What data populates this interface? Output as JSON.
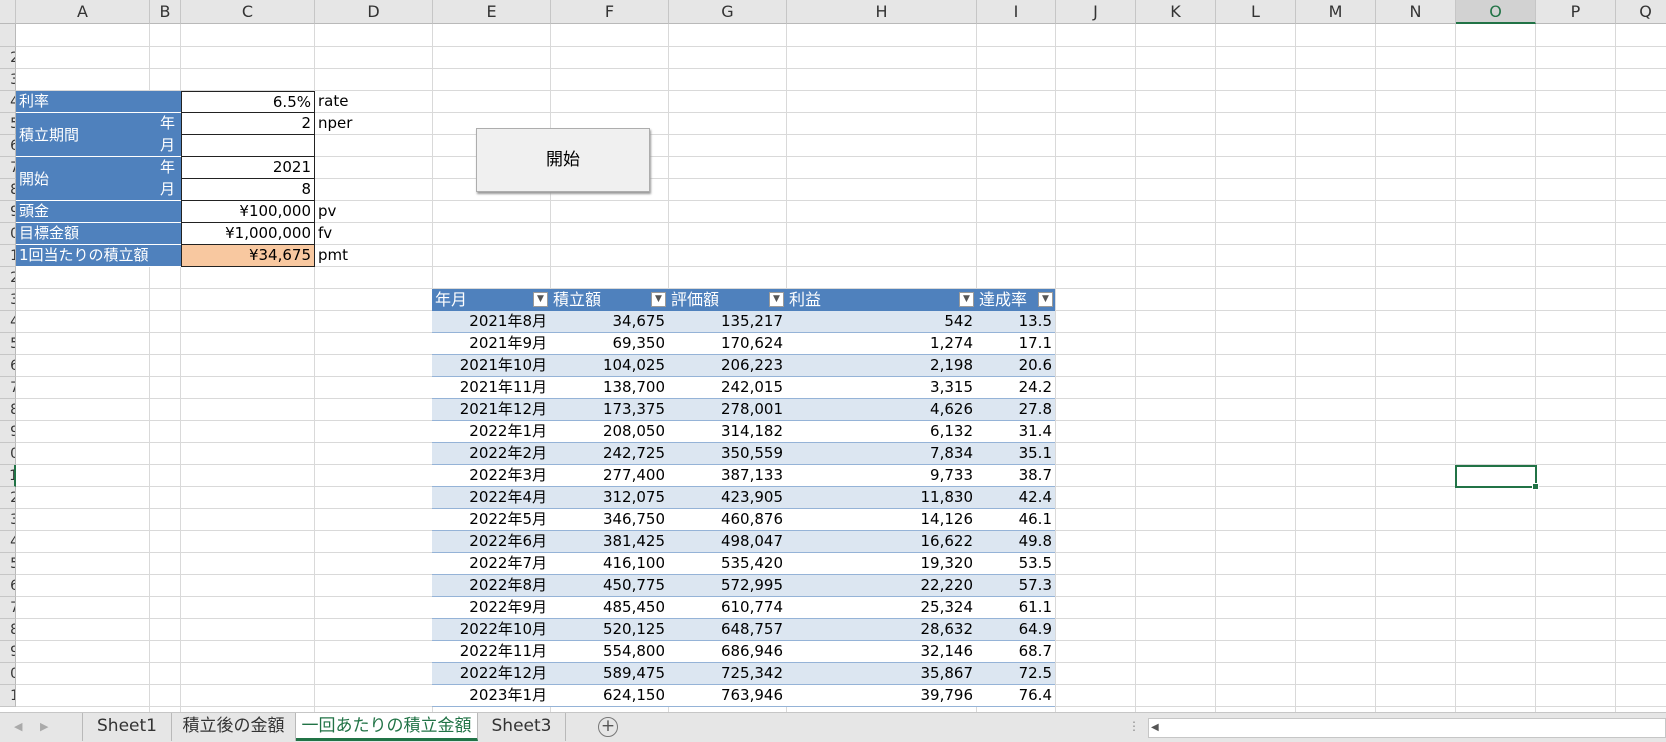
{
  "columns": [
    "A",
    "B",
    "C",
    "D",
    "E",
    "F",
    "G",
    "H",
    "I",
    "J",
    "K",
    "L",
    "M",
    "N",
    "O",
    "P",
    "Q"
  ],
  "rows": [
    "",
    "2",
    "3",
    "4",
    "5",
    "6",
    "7",
    "8",
    "9",
    "0",
    "1",
    "2",
    "3",
    "4",
    "5",
    "6",
    "7",
    "8",
    "9",
    "0",
    "1",
    "2",
    "3",
    "4",
    "5",
    "6",
    "7",
    "8",
    "9",
    "0",
    "1"
  ],
  "inputs": {
    "rate_label": "利率",
    "rate_value": "6.5%",
    "rate_note": "rate",
    "period_label": "積立期間",
    "period_year_unit": "年",
    "period_month_unit": "月",
    "period_year_value": "2",
    "period_note": "nper",
    "start_label": "開始",
    "start_year_unit": "年",
    "start_month_unit": "月",
    "start_year_value": "2021",
    "start_month_value": "8",
    "pv_label": "頭金",
    "pv_value": "¥100,000",
    "pv_note": "pv",
    "fv_label": "目標金額",
    "fv_value": "¥1,000,000",
    "fv_note": "fv",
    "pmt_label": "1回当たりの積立額",
    "pmt_value": "¥34,675",
    "pmt_note": "pmt"
  },
  "start_button": "開始",
  "table": {
    "headers": [
      "年月",
      "積立額",
      "評価額",
      "利益",
      "達成率"
    ],
    "rows": [
      [
        "2021年8月",
        "34,675",
        "135,217",
        "542",
        "13.5"
      ],
      [
        "2021年9月",
        "69,350",
        "170,624",
        "1,274",
        "17.1"
      ],
      [
        "2021年10月",
        "104,025",
        "206,223",
        "2,198",
        "20.6"
      ],
      [
        "2021年11月",
        "138,700",
        "242,015",
        "3,315",
        "24.2"
      ],
      [
        "2021年12月",
        "173,375",
        "278,001",
        "4,626",
        "27.8"
      ],
      [
        "2022年1月",
        "208,050",
        "314,182",
        "6,132",
        "31.4"
      ],
      [
        "2022年2月",
        "242,725",
        "350,559",
        "7,834",
        "35.1"
      ],
      [
        "2022年3月",
        "277,400",
        "387,133",
        "9,733",
        "38.7"
      ],
      [
        "2022年4月",
        "312,075",
        "423,905",
        "11,830",
        "42.4"
      ],
      [
        "2022年5月",
        "346,750",
        "460,876",
        "14,126",
        "46.1"
      ],
      [
        "2022年6月",
        "381,425",
        "498,047",
        "16,622",
        "49.8"
      ],
      [
        "2022年7月",
        "416,100",
        "535,420",
        "19,320",
        "53.5"
      ],
      [
        "2022年8月",
        "450,775",
        "572,995",
        "22,220",
        "57.3"
      ],
      [
        "2022年9月",
        "485,450",
        "610,774",
        "25,324",
        "61.1"
      ],
      [
        "2022年10月",
        "520,125",
        "648,757",
        "28,632",
        "64.9"
      ],
      [
        "2022年11月",
        "554,800",
        "686,946",
        "32,146",
        "68.7"
      ],
      [
        "2022年12月",
        "589,475",
        "725,342",
        "35,867",
        "72.5"
      ],
      [
        "2023年1月",
        "624,150",
        "763,946",
        "39,796",
        "76.4"
      ]
    ]
  },
  "tabs": [
    "Sheet1",
    "積立後の金額",
    "一回あたりの積立金額",
    "Sheet3"
  ],
  "active_tab": 2,
  "colors": {
    "header_blue": "#4f81bd",
    "band": "#dce6f1",
    "result_orange": "#f8c8a0",
    "accent_green": "#217346"
  }
}
